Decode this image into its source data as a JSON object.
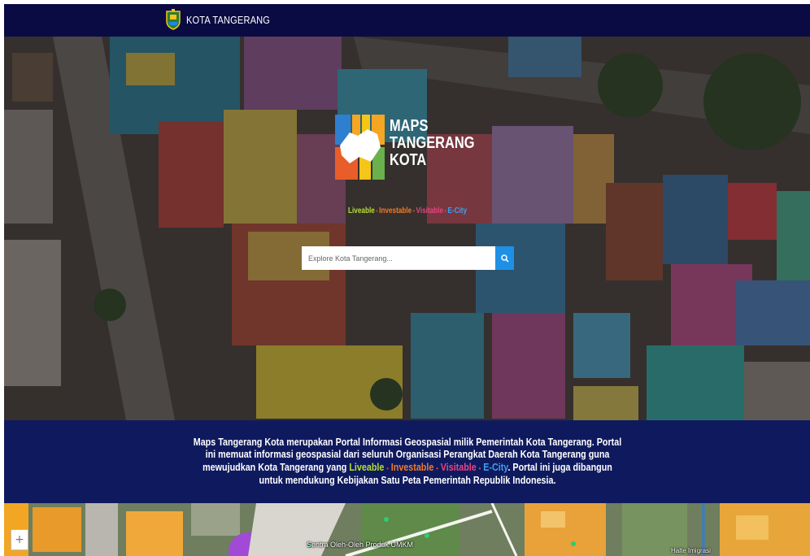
{
  "header": {
    "brand": "KOTA TANGERANG",
    "crest_icon": "city-crest-icon"
  },
  "hero": {
    "logo_lines": [
      "MAPS",
      "TANGERANG",
      "KOTA"
    ],
    "tagline": {
      "liveable": "Liveable",
      "investable": "Investable",
      "visitable": "Visitable",
      "ecity": "E-City",
      "separator": "•"
    },
    "search": {
      "placeholder": "Explore Kota Tangerang...",
      "value": "",
      "button_icon": "search-icon"
    }
  },
  "description": {
    "part1": "Maps Tangerang Kota merupakan Portal Informasi Geospasial milik Pemerintah Kota Tangerang. Portal ini memuat informasi geospasial dari seluruh Organisasi Perangkat Daerah Kota Tangerang guna mewujudkan Kota Tangerang yang ",
    "liveable": "Liveable",
    "investable": "Investable",
    "visitable": "Visitable",
    "ecity": "E-City",
    "separator": "•",
    "part2": ". Portal ini juga dibangun untuk mendukung Kebijakan Satu Peta Pemerintah Republik Indonesia."
  },
  "map": {
    "label_sentra": "Sentra Oleh-Oleh Produk UMKM",
    "label_halte": "Halte Imigrasi",
    "zoom_in": "+"
  },
  "colors": {
    "navy": "#0b0b44",
    "band": "#0f1a5e",
    "accent_blue": "#1e90e6",
    "liveable": "#b6e031",
    "investable": "#f07a2a",
    "visitable": "#e8447f",
    "ecity": "#3ea0f0"
  }
}
